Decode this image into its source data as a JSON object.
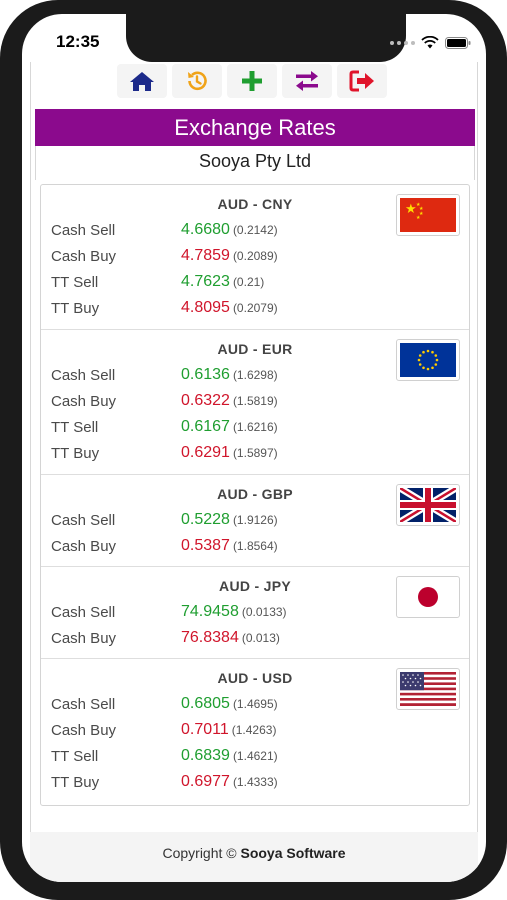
{
  "status": {
    "time": "12:35"
  },
  "nav": {
    "icons": [
      "home-icon",
      "history-icon",
      "add-icon",
      "exchange-icon",
      "logout-icon"
    ],
    "colors": {
      "home": "#1c2a8a",
      "history": "#f0a318",
      "add": "#1f9e30",
      "exchange": "#8b0a8d",
      "logout": "#e0142b"
    }
  },
  "header": {
    "title": "Exchange Rates",
    "company": "Sooya Pty Ltd"
  },
  "cards": [
    {
      "pair": "AUD - CNY",
      "flag": "china-flag-icon",
      "rates": [
        {
          "label": "Cash Sell",
          "value": "4.6680",
          "inverse": "(0.2142)"
        },
        {
          "label": "Cash Buy",
          "value": "4.7859",
          "inverse": "(0.2089)"
        },
        {
          "label": "TT Sell",
          "value": "4.7623",
          "inverse": "(0.21)"
        },
        {
          "label": "TT Buy",
          "value": "4.8095",
          "inverse": "(0.2079)"
        }
      ]
    },
    {
      "pair": "AUD - EUR",
      "flag": "eu-flag-icon",
      "rates": [
        {
          "label": "Cash Sell",
          "value": "0.6136",
          "inverse": "(1.6298)"
        },
        {
          "label": "Cash Buy",
          "value": "0.6322",
          "inverse": "(1.5819)"
        },
        {
          "label": "TT Sell",
          "value": "0.6167",
          "inverse": "(1.6216)"
        },
        {
          "label": "TT Buy",
          "value": "0.6291",
          "inverse": "(1.5897)"
        }
      ]
    },
    {
      "pair": "AUD - GBP",
      "flag": "uk-flag-icon",
      "rates": [
        {
          "label": "Cash Sell",
          "value": "0.5228",
          "inverse": "(1.9126)"
        },
        {
          "label": "Cash Buy",
          "value": "0.5387",
          "inverse": "(1.8564)"
        }
      ]
    },
    {
      "pair": "AUD - JPY",
      "flag": "japan-flag-icon",
      "rates": [
        {
          "label": "Cash Sell",
          "value": "74.9458",
          "inverse": "(0.0133)"
        },
        {
          "label": "Cash Buy",
          "value": "76.8384",
          "inverse": "(0.013)"
        }
      ]
    },
    {
      "pair": "AUD - USD",
      "flag": "us-flag-icon",
      "rates": [
        {
          "label": "Cash Sell",
          "value": "0.6805",
          "inverse": "(1.4695)"
        },
        {
          "label": "Cash Buy",
          "value": "0.7011",
          "inverse": "(1.4263)"
        },
        {
          "label": "TT Sell",
          "value": "0.6839",
          "inverse": "(1.4621)"
        },
        {
          "label": "TT Buy",
          "value": "0.6977",
          "inverse": "(1.4333)"
        }
      ]
    }
  ],
  "footer": {
    "prefix": "Copyright ©",
    "brand": "Sooya Software"
  },
  "colors": {
    "sell": "#1f9e30",
    "buy": "#d0152b",
    "title_bar": "#8b0a8d"
  }
}
